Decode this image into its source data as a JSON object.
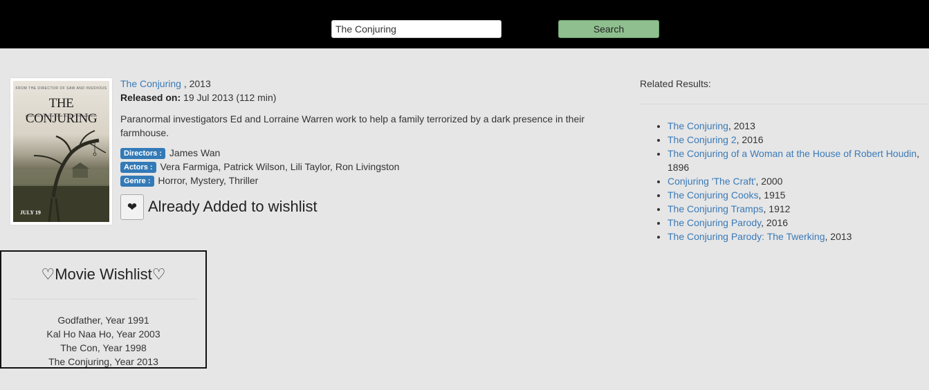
{
  "search": {
    "value": "The Conjuring",
    "button_label": "Search"
  },
  "poster": {
    "top_text": "FROM THE DIRECTOR OF SAW AND INSIDIOUS",
    "title": "THE CONJURING",
    "tagline": "BASED ON THE TRUE CASE FILES OF THE WARRENS",
    "date": "JULY 19"
  },
  "movie": {
    "title": "The Conjuring",
    "year_suffix": " , 2013",
    "released_label": "Released on:",
    "released_value": " 19 Jul 2013 (112 min)",
    "plot": "Paranormal investigators Ed and Lorraine Warren work to help a family terrorized by a dark presence in their farmhouse.",
    "directors_label": "Directors :",
    "directors": " James Wan",
    "actors_label": "Actors :",
    "actors": " Vera Farmiga, Patrick Wilson, Lili Taylor, Ron Livingston",
    "genre_label": "Genre :",
    "genre": " Horror, Mystery, Thriller",
    "wishlist_icon": "heart-icon",
    "wishlist_status": "Already Added to wishlist"
  },
  "related": {
    "label": "Related Results:",
    "items": [
      {
        "title": "The Conjuring",
        "year": ", 2013"
      },
      {
        "title": "The Conjuring 2",
        "year": ", 2016"
      },
      {
        "title": "The Conjuring of a Woman at the House of Robert Houdin",
        "year": ", 1896"
      },
      {
        "title": "Conjuring 'The Craft'",
        "year": ", 2000"
      },
      {
        "title": "The Conjuring Cooks",
        "year": ", 1915"
      },
      {
        "title": "The Conjuring Tramps",
        "year": ", 1912"
      },
      {
        "title": "The Conjuring Parody",
        "year": ", 2016"
      },
      {
        "title": "The Conjuring Parody: The Twerking",
        "year": ", 2013"
      }
    ]
  },
  "wishlist": {
    "title": "♡Movie Wishlist♡",
    "items": [
      "Godfather, Year 1991",
      "Kal Ho Naa Ho, Year 2003",
      "The Con, Year 1998",
      "The Conjuring, Year 2013"
    ]
  },
  "colors": {
    "topbar": "#000000",
    "link": "#3a7ab8",
    "badge": "#337ab7",
    "search_button": "#8fbf8f",
    "background": "#e6e6e6"
  }
}
